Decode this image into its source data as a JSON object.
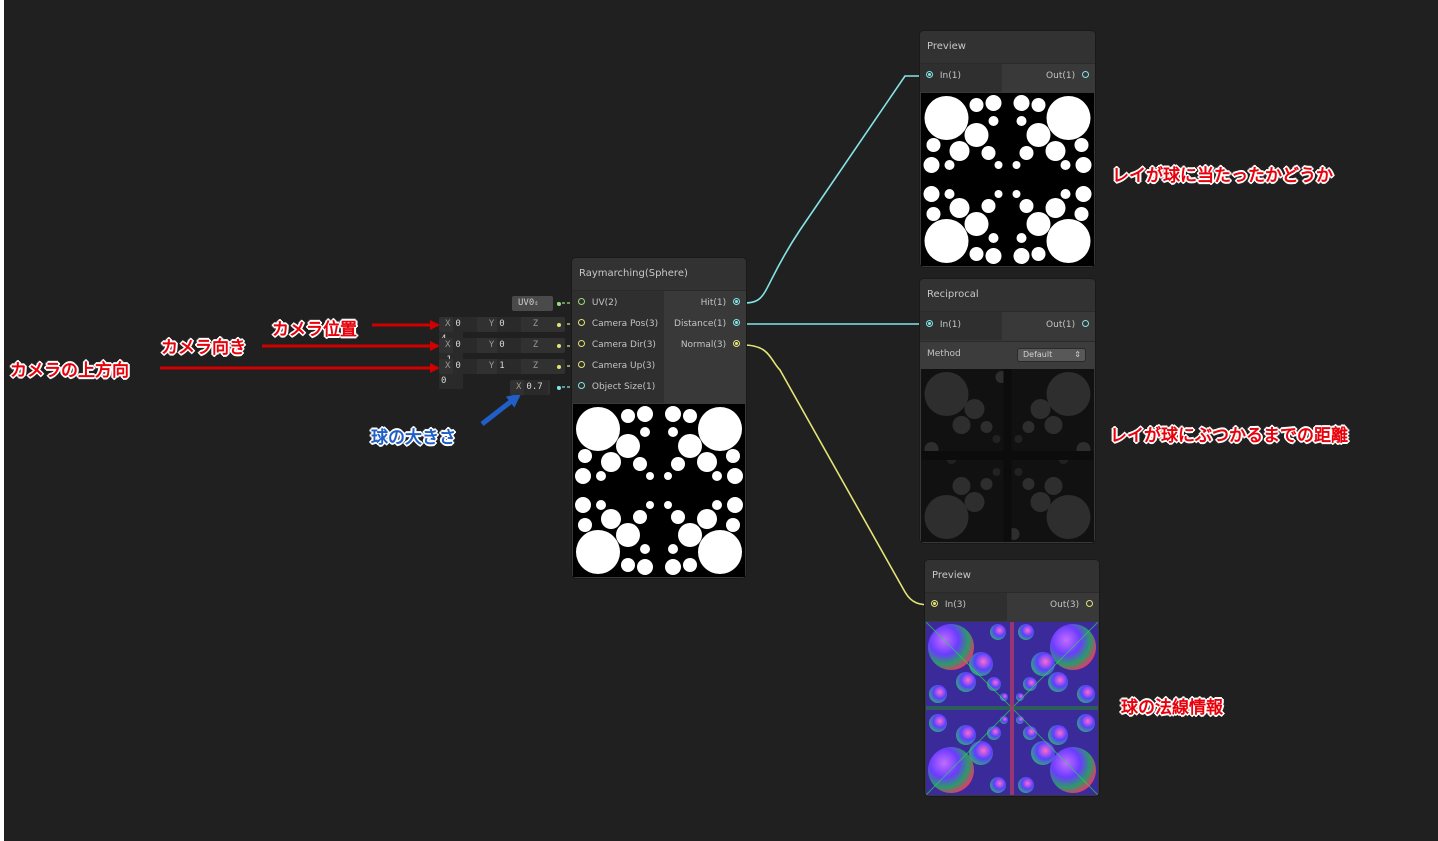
{
  "colors": {
    "canvas": "#202020",
    "node": "#383838",
    "wire_cyan": "#84e4e7",
    "wire_yellow": "#e4e476",
    "annot_red": "#e8000b",
    "annot_blue": "#1f5fc7"
  },
  "raymarching_node": {
    "title": "Raymarching(Sphere)",
    "inputs": [
      {
        "label": "UV(2)",
        "port_color": "green"
      },
      {
        "label": "Camera Pos(3)",
        "port_color": "yellow"
      },
      {
        "label": "Camera Dir(3)",
        "port_color": "yellow"
      },
      {
        "label": "Camera Up(3)",
        "port_color": "yellow"
      },
      {
        "label": "Object Size(1)",
        "port_color": "cyan"
      }
    ],
    "outputs": [
      {
        "label": "Hit(1)",
        "port_color": "cyan"
      },
      {
        "label": "Distance(1)",
        "port_color": "cyan"
      },
      {
        "label": "Normal(3)",
        "port_color": "yellow"
      }
    ]
  },
  "input_fields": {
    "uv": {
      "value": "UV0",
      "icon": "spinner-arrows-icon"
    },
    "camera_pos": {
      "x_label": "X",
      "x": "0",
      "y_label": "Y",
      "y": "0",
      "z_label": "Z",
      "z": "4"
    },
    "camera_dir": {
      "x_label": "X",
      "x": "0",
      "y_label": "Y",
      "y": "0",
      "z_label": "Z",
      "z": "-1"
    },
    "camera_up": {
      "x_label": "X",
      "x": "0",
      "y_label": "Y",
      "y": "1",
      "z_label": "Z",
      "z": "0"
    },
    "object_size": {
      "x_label": "X",
      "x": "0.7"
    }
  },
  "preview_node_1": {
    "title": "Preview",
    "input": "In(1)",
    "output": "Out(1)"
  },
  "reciprocal_node": {
    "title": "Reciprocal",
    "input": "In(1)",
    "output": "Out(1)",
    "method_label": "Method",
    "method_value": "Default"
  },
  "preview_node_2": {
    "title": "Preview",
    "input": "In(3)",
    "output": "Out(3)"
  },
  "annotations": {
    "camera_pos": "カメラ位置",
    "camera_dir": "カメラ向き",
    "camera_up": "カメラの上方向",
    "object_size": "球の大きさ",
    "hit": "レイが球に当たったかどうか",
    "distance": "レイが球にぶつかるまでの距離",
    "normal": "球の法線情報"
  }
}
